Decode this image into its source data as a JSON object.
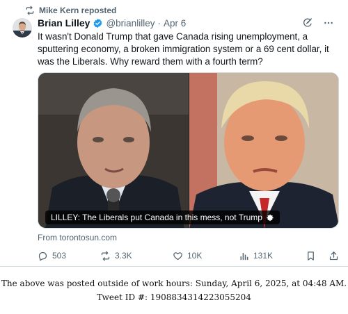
{
  "repost": {
    "label": "Mike Kern reposted",
    "icon": "retweet-icon"
  },
  "tweet": {
    "author_name": "Brian Lilley",
    "handle": "@brianlilley",
    "separator": "·",
    "date": "Apr 6",
    "text": "It wasn't Donald Trump that gave Canada rising unemployment, a sputtering economy, a broken immigration system or a 69 cent dollar, it was the Liberals. Why reward them with a fourth term?",
    "media_caption": "LILLEY: The Liberals put Canada in this mess, not Trump",
    "link_source": "From torontosun.com",
    "stats": {
      "replies": "503",
      "reposts": "3.3K",
      "likes": "10K",
      "views": "131K"
    }
  },
  "footer": {
    "line1": "The above was posted outside of work hours: Sunday, April 6, 2025, at 04:48 AM.",
    "line2": "Tweet ID #: 1908834314223055204"
  },
  "colors": {
    "secondary_text": "#536471",
    "verified_blue": "#1d9bf0",
    "border": "#cfd9de"
  }
}
